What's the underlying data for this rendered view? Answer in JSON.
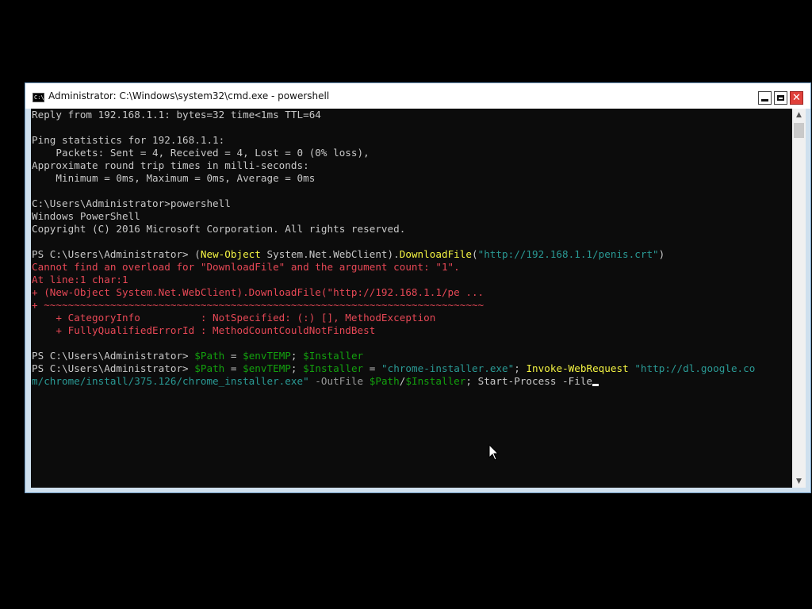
{
  "window": {
    "title": "Administrator: C:\\Windows\\system32\\cmd.exe - powershell",
    "icon": "cmd-console-icon",
    "icon_label": "C:\\",
    "buttons": {
      "minimize": "minimize-icon",
      "maximize": "maximize-icon",
      "close": "close-icon"
    },
    "close_glyph": "✕"
  },
  "console": {
    "background": "#0c0c0c",
    "lines": [
      [
        {
          "t": "Reply from 192.168.1.1: bytes=32 time<1ms TTL=64",
          "c": "white"
        }
      ],
      [
        {
          "t": "",
          "c": "white"
        }
      ],
      [
        {
          "t": "Ping statistics for 192.168.1.1:",
          "c": "white"
        }
      ],
      [
        {
          "t": "    Packets: Sent = 4, Received = 4, Lost = 0 (0% loss),",
          "c": "white"
        }
      ],
      [
        {
          "t": "Approximate round trip times in milli-seconds:",
          "c": "white"
        }
      ],
      [
        {
          "t": "    Minimum = 0ms, Maximum = 0ms, Average = 0ms",
          "c": "white"
        }
      ],
      [
        {
          "t": "",
          "c": "white"
        }
      ],
      [
        {
          "t": "C:\\Users\\Administrator>powershell",
          "c": "white"
        }
      ],
      [
        {
          "t": "Windows PowerShell",
          "c": "white"
        }
      ],
      [
        {
          "t": "Copyright (C) 2016 Microsoft Corporation. All rights reserved.",
          "c": "white"
        }
      ],
      [
        {
          "t": "",
          "c": "white"
        }
      ],
      [
        {
          "t": "PS C:\\Users\\Administrator> (",
          "c": "white"
        },
        {
          "t": "New-Object",
          "c": "yellow"
        },
        {
          "t": " System.Net.WebClient).",
          "c": "white"
        },
        {
          "t": "DownloadFile",
          "c": "yellow"
        },
        {
          "t": "(",
          "c": "white"
        },
        {
          "t": "\"http://192.168.1.1/penis.crt\"",
          "c": "teal"
        },
        {
          "t": ")",
          "c": "white"
        }
      ],
      [
        {
          "t": "Cannot find an overload for \"DownloadFile\" and the argument count: \"1\".",
          "c": "red"
        }
      ],
      [
        {
          "t": "At line:1 char:1",
          "c": "red"
        }
      ],
      [
        {
          "t": "+ (New-Object System.Net.WebClient).DownloadFile(\"http://192.168.1.1/pe ...",
          "c": "red"
        }
      ],
      [
        {
          "t": "+ ~~~~~~~~~~~~~~~~~~~~~~~~~~~~~~~~~~~~~~~~~~~~~~~~~~~~~~~~~~~~~~~~~~~~~~~~~",
          "c": "red"
        }
      ],
      [
        {
          "t": "    + CategoryInfo          : NotSpecified: (:) [], MethodException",
          "c": "red"
        }
      ],
      [
        {
          "t": "    + FullyQualifiedErrorId : MethodCountCouldNotFindBest",
          "c": "red"
        }
      ],
      [
        {
          "t": "",
          "c": "white"
        }
      ],
      [
        {
          "t": "PS C:\\Users\\Administrator> ",
          "c": "white"
        },
        {
          "t": "$Path",
          "c": "green"
        },
        {
          "t": " = ",
          "c": "white"
        },
        {
          "t": "$envTEMP",
          "c": "green"
        },
        {
          "t": "; ",
          "c": "white"
        },
        {
          "t": "$Installer",
          "c": "green"
        }
      ],
      [
        {
          "t": "PS C:\\Users\\Administrator> ",
          "c": "white"
        },
        {
          "t": "$Path",
          "c": "green"
        },
        {
          "t": " = ",
          "c": "white"
        },
        {
          "t": "$envTEMP",
          "c": "green"
        },
        {
          "t": "; ",
          "c": "white"
        },
        {
          "t": "$Installer",
          "c": "green"
        },
        {
          "t": " = ",
          "c": "white"
        },
        {
          "t": "\"chrome-installer.exe\"",
          "c": "teal"
        },
        {
          "t": "; ",
          "c": "white"
        },
        {
          "t": "Invoke-WebRequest",
          "c": "yellow"
        },
        {
          "t": " ",
          "c": "white"
        },
        {
          "t": "\"http://dl.google.co",
          "c": "teal"
        }
      ],
      [
        {
          "t": "m/chrome/install/375.126/chrome_installer.exe\"",
          "c": "teal"
        },
        {
          "t": " -OutFile ",
          "c": "grey"
        },
        {
          "t": "$Path",
          "c": "green"
        },
        {
          "t": "/",
          "c": "white"
        },
        {
          "t": "$Installer",
          "c": "green"
        },
        {
          "t": "; Start-Process -File",
          "c": "white"
        }
      ]
    ]
  },
  "scrollbar": {
    "up_icon": "scroll-up-arrow-icon",
    "down_icon": "scroll-down-arrow-icon",
    "up_glyph": "▲",
    "down_glyph": "▼"
  },
  "pointer": {
    "icon": "mouse-pointer-icon"
  },
  "colors": {
    "white": "#c8c8c8",
    "yellow": "#f5f543",
    "red": "#e74856",
    "teal": "#2a9a95",
    "grey": "#9a9a9a",
    "green": "#13a10e",
    "titlebar": "#ffffff",
    "window_border": "#cfe0ee",
    "close_button": "#e0403a"
  }
}
